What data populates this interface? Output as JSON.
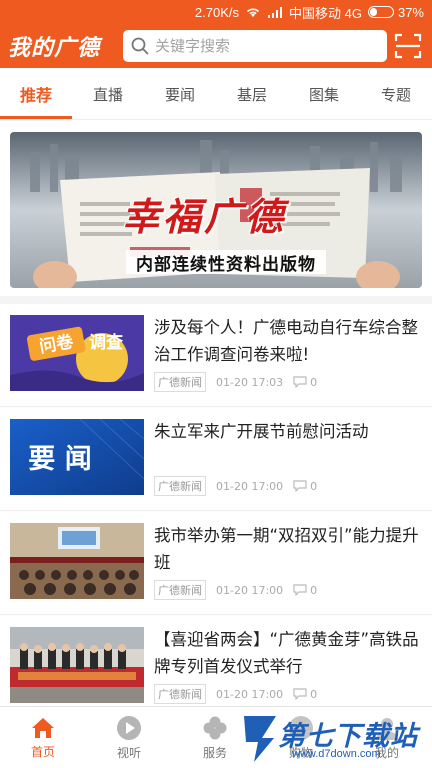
{
  "status_bar": {
    "speed": "2.70K/s",
    "carrier": "中国移动 4G",
    "battery_percent": "37%",
    "battery_level": 0.37
  },
  "header": {
    "app_title": "我的广德",
    "search_placeholder": "关键字搜索",
    "search_icon": "search-icon",
    "scan_icon": "scan-icon"
  },
  "tabs": [
    {
      "label": "推荐",
      "active": true
    },
    {
      "label": "直播",
      "active": false
    },
    {
      "label": "要闻",
      "active": false
    },
    {
      "label": "基层",
      "active": false
    },
    {
      "label": "图集",
      "active": false
    },
    {
      "label": "专题",
      "active": false
    }
  ],
  "banner": {
    "title": "幸福广德",
    "caption": "内部连续性资料出版物"
  },
  "news": [
    {
      "title": "涉及每个人！广德电动自行车综合整治工作调查问卷来啦!",
      "source": "广德新闻",
      "time": "01-20 17:03",
      "comments": "0",
      "thumb_text": "问卷调查"
    },
    {
      "title": "朱立军来广开展节前慰问活动",
      "source": "广德新闻",
      "time": "01-20 17:00",
      "comments": "0",
      "thumb_text": "要 闻"
    },
    {
      "title": "我市举办第一期“双招双引”能力提升班",
      "source": "广德新闻",
      "time": "01-20 17:00",
      "comments": "0",
      "thumb_text": ""
    },
    {
      "title": "【喜迎省两会】“广德黄金芽”高铁品牌专列首发仪式举行",
      "source": "广德新闻",
      "time": "01-20 17:00",
      "comments": "0",
      "thumb_text": ""
    }
  ],
  "bottom_nav": [
    {
      "label": "首页",
      "icon": "home-icon",
      "active": true
    },
    {
      "label": "视听",
      "icon": "play-icon",
      "active": false
    },
    {
      "label": "服务",
      "icon": "clover-icon",
      "active": false
    },
    {
      "label": "购物",
      "icon": "shop-icon",
      "active": false
    },
    {
      "label": "我的",
      "icon": "user-icon",
      "active": false
    }
  ],
  "watermark": {
    "text": "第七下载站",
    "url": "www.d7down.com"
  },
  "colors": {
    "brand": "#ee5a1f",
    "watermark": "#1f5fb5"
  }
}
